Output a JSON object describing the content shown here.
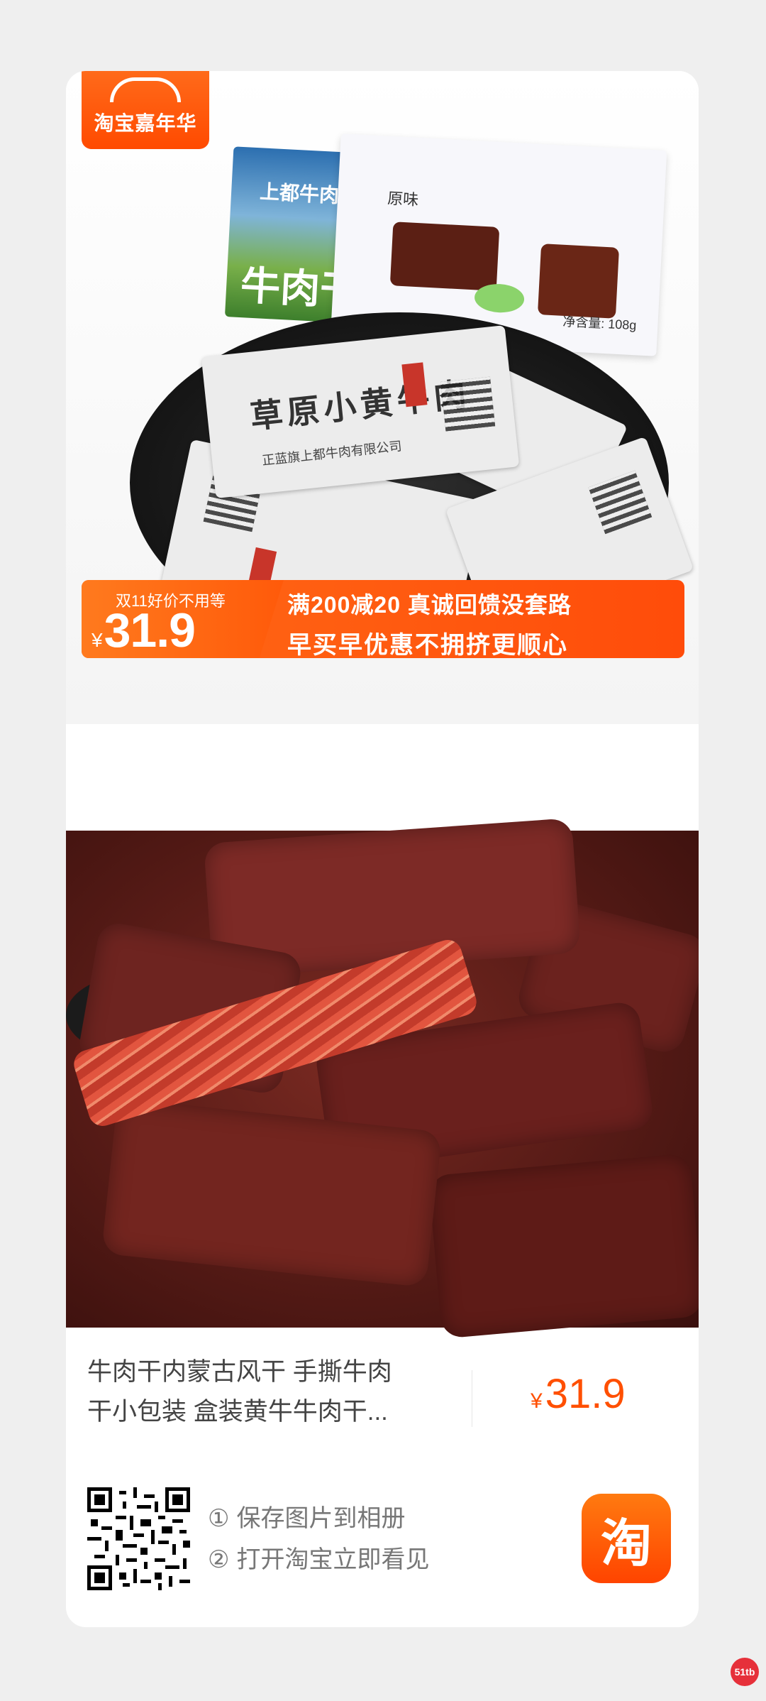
{
  "brand": {
    "tag_label": "淘宝嘉年华"
  },
  "hero": {
    "box_brand": "上都牛肉",
    "box_title": "牛肉干",
    "box_flavor": "原味",
    "box_weight": "净含量: 108g",
    "packet_title": "草原小黄牛肉",
    "packet_company": "正蓝旗上都牛肉有限公司"
  },
  "promo": {
    "tag": "双11好价不用等",
    "currency": "¥",
    "price": "31.9",
    "line1": "满200减20 真诚回馈没套路",
    "line2": "早买早优惠不拥挤更顺心"
  },
  "product": {
    "title_line1": "牛肉干内蒙古风干 手撕牛肉",
    "title_line2": "干小包装 盒装黄牛牛肉干...",
    "currency": "¥",
    "price": "31.9"
  },
  "footer": {
    "step1_num": "①",
    "step1_text": "保存图片到相册",
    "step2_num": "②",
    "step2_text": "打开淘宝立即看见",
    "logo_char": "淘"
  },
  "watermark": {
    "text": "51tb"
  },
  "colors": {
    "accent": "#ff4f00",
    "promo": "#ff5a0a",
    "background": "#efefef"
  }
}
